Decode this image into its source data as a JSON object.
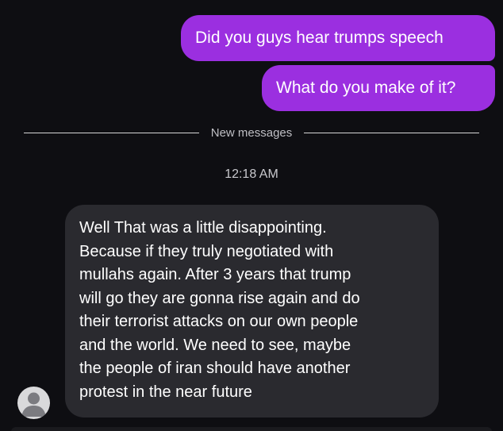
{
  "outgoing_messages": [
    {
      "text": "Did you guys hear trumps speech"
    },
    {
      "text": "What do you make of it?"
    }
  ],
  "divider": {
    "label": "New messages"
  },
  "timestamp": "12:18 AM",
  "incoming_message": {
    "lines": [
      "Well That was a little disappointing.",
      "Because if they truly negotiated with",
      "mullahs again. After 3 years that trump",
      "will go they are gonna rise again and do",
      "their terrorist attacks on our own people",
      "and the world. We need to see, maybe",
      "the people of iran should have another",
      "protest in the near future"
    ]
  },
  "avatar": {
    "icon": "default-user-icon"
  },
  "colors": {
    "background": "#0e0e12",
    "outgoing_bubble": "#9b2fe0",
    "incoming_bubble": "#2a2a2f",
    "text": "#ffffff"
  }
}
